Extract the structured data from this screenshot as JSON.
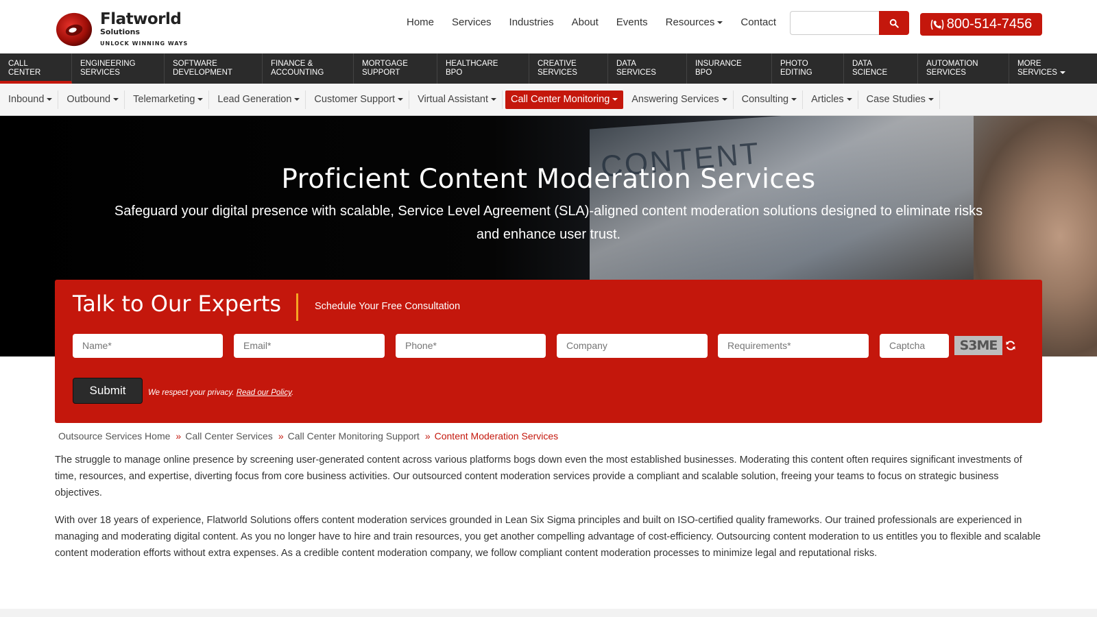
{
  "brand": {
    "name": "Flatworld",
    "sub": "Solutions",
    "tagline": "UNLOCK WINNING WAYS",
    "accent": "#c4170c"
  },
  "topnav": {
    "items": [
      "Home",
      "Services",
      "Industries",
      "About",
      "Events",
      "Resources",
      "Contact"
    ],
    "search_placeholder": "",
    "search_icon": "search-icon",
    "phone": "800-514-7456"
  },
  "mainnav": {
    "items": [
      {
        "line1": "CALL",
        "line2": "CENTER",
        "active": true
      },
      {
        "line1": "ENGINEERING",
        "line2": "SERVICES"
      },
      {
        "line1": "SOFTWARE",
        "line2": "DEVELOPMENT"
      },
      {
        "line1": "FINANCE &",
        "line2": "ACCOUNTING"
      },
      {
        "line1": "MORTGAGE",
        "line2": "SUPPORT"
      },
      {
        "line1": "HEALTHCARE",
        "line2": "BPO"
      },
      {
        "line1": "CREATIVE",
        "line2": "SERVICES"
      },
      {
        "line1": "DATA",
        "line2": "SERVICES"
      },
      {
        "line1": "INSURANCE",
        "line2": "BPO"
      },
      {
        "line1": "PHOTO",
        "line2": "EDITING"
      },
      {
        "line1": "DATA",
        "line2": "SCIENCE"
      },
      {
        "line1": "AUTOMATION",
        "line2": "SERVICES"
      },
      {
        "line1": "MORE",
        "line2": "SERVICES"
      }
    ]
  },
  "subnav": {
    "items": [
      "Inbound",
      "Outbound",
      "Telemarketing",
      "Lead Generation",
      "Customer Support",
      "Virtual Assistant",
      "Call Center Monitoring",
      "Answering Services",
      "Consulting",
      "Articles",
      "Case Studies"
    ],
    "active_index": 6
  },
  "hero": {
    "bg_word": "CONTENT",
    "title": "Proficient Content Moderation Services",
    "subtitle": "Safeguard your digital presence with scalable, Service Level Agreement (SLA)-aligned content moderation solutions designed to eliminate risks and enhance user trust."
  },
  "form": {
    "title": "Talk to Our Experts",
    "subtitle": "Schedule Your Free Consultation",
    "fields": {
      "name": "Name*",
      "email": "Email*",
      "phone": "Phone*",
      "company": "Company",
      "requirements": "Requirements*",
      "captcha": "Captcha"
    },
    "captcha_text": "S3ME",
    "submit_label": "Submit",
    "privacy_text": "We respect your privacy.",
    "privacy_link": "Read our Policy"
  },
  "breadcrumb": {
    "items": [
      "Outsource Services Home",
      "Call Center Services",
      "Call Center Monitoring Support",
      "Content Moderation Services"
    ],
    "separator": "»"
  },
  "content": {
    "p1": "The struggle to manage online presence by screening user-generated content across various platforms bogs down even the most established businesses. Moderating this content often requires significant investments of time, resources, and expertise, diverting focus from core business activities. Our outsourced content moderation services provide a compliant and scalable solution, freeing your teams to focus on strategic business objectives.",
    "p2": "With over 18 years of experience, Flatworld Solutions offers content moderation services grounded in Lean Six Sigma principles and built on ISO-certified quality frameworks. Our trained professionals are experienced in managing and moderating digital content. As you no longer have to hire and train resources, you get another compelling advantage of cost-efficiency. Outsourcing content moderation to us entitles you to flexible and scalable content moderation efforts without extra expenses. As a credible content moderation company, we follow compliant content moderation processes to minimize legal and reputational risks."
  }
}
